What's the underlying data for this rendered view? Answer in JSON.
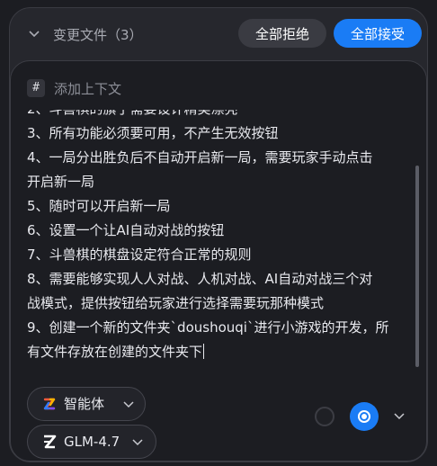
{
  "header": {
    "changes_label": "变更文件（3）",
    "reject_all_label": "全部拒绝",
    "accept_all_label": "全部接受"
  },
  "editor": {
    "context_symbol": "#",
    "context_label": "添加上下文",
    "lines": [
      "2、斗兽棋的旗子需要设计精美漂亮",
      "3、所有功能必须要可用，不产生无效按钮",
      "4、一局分出胜负后不自动开启新一局，需要玩家手动点击",
      "开启新一局",
      "5、随时可以开启新一局",
      "6、设置一个让AI自动对战的按钮",
      "7、斗兽棋的棋盘设定符合正常的规则",
      "8、需要能够实现人人对战、人机对战、AI自动对战三个对",
      "战模式，提供按钮给玩家进行选择需要玩那种模式",
      "9、创建一个新的文件夹`doushouqi`进行小游戏的开发，所",
      "有文件存放在创建的文件夹下"
    ]
  },
  "toolbar": {
    "agent_label": "智能体",
    "model_label": "GLM-4.7"
  },
  "colors": {
    "accent": "#1a7cf5",
    "panel": "#26272d",
    "editor_bg": "#1c1d22"
  },
  "icons": {
    "collapse": "chevron-down-icon",
    "agent": "agent-logo-icon",
    "model": "zhipu-logo-icon",
    "send": "record-icon"
  }
}
